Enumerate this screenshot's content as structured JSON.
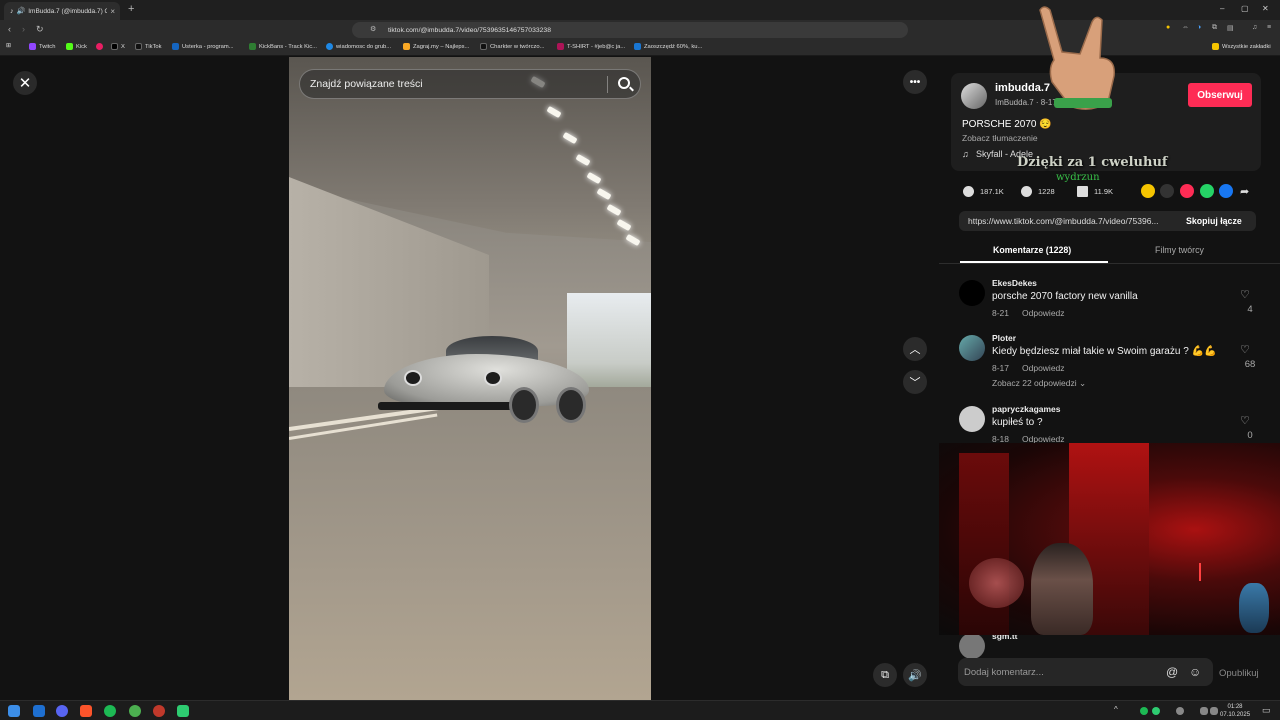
{
  "browser": {
    "tab_title": "ImBudda.7 (@imbudda.7) Oficj",
    "tab_close": "×",
    "new_tab": "+",
    "url": "tiktok.com/@imbudda.7/video/7539635146757033238",
    "window_controls": [
      "–",
      "▢",
      "✕"
    ],
    "bookmarks": [
      {
        "label": "Twitch",
        "color": "#9146ff"
      },
      {
        "label": "Kick",
        "color": "#53fc18"
      },
      {
        "label": "",
        "color": "#e91e63"
      },
      {
        "label": "X",
        "color": "#000000"
      },
      {
        "label": "TikTok",
        "color": "#111111"
      },
      {
        "label": "Usterka - program...",
        "color": "#1565c0"
      },
      {
        "label": "KickBans - Track Kic...",
        "color": "#2e7d32"
      },
      {
        "label": "wiadomosc do grub...",
        "color": "#1e88e5"
      },
      {
        "label": "Zagraj.my – Najleps...",
        "color": "#f9a825"
      },
      {
        "label": "Charkter w twórczo...",
        "color": "#111111"
      },
      {
        "label": "T-SHIRT - #jeb@c ja...",
        "color": "#ad1457"
      },
      {
        "label": "Zaoszczędź 60%, ku...",
        "color": "#1976d2"
      }
    ],
    "all_bookmarks": "Wszystkie zakładki"
  },
  "video": {
    "search_placeholder": "Znajdź powiązane treści",
    "more_label": "•••"
  },
  "post": {
    "username": "imbudda.7",
    "handle_date": "ImBudda.7 · 8-17",
    "follow_label": "Obserwuj",
    "caption": "PORSCHE 2070 😌",
    "translate_label": "Zobacz tłumaczenie",
    "music": "Skyfall - Adele",
    "likes": "187.1K",
    "comments_count": "1228",
    "saves": "11.9K",
    "link": "https://www.tiktok.com/@imbudda.7/video/75396...",
    "copy_label": "Skopiuj łącze"
  },
  "tabs": {
    "comments": "Komentarze (1228)",
    "creator_videos": "Filmy twórcy"
  },
  "comments": [
    {
      "name": "EkesDekes",
      "text": "porsche 2070 factory new vanilla",
      "date": "8-21",
      "reply": "Odpowiedz",
      "likes": "4"
    },
    {
      "name": "Ploter",
      "text": "Kiedy będziesz miał takie w Swoim garażu ? 💪💪",
      "date": "8-17",
      "reply": "Odpowiedz",
      "likes": "68",
      "more": "Zobacz 22 odpowiedzi ⌄"
    },
    {
      "name": "papryczkagames",
      "text": "kupiłeś to ?",
      "date": "8-18",
      "reply": "Odpowiedz",
      "likes": "0"
    },
    {
      "name": "sgm.tt"
    }
  ],
  "compose": {
    "placeholder": "Dodaj komentarz...",
    "post_label": "Opublikuj"
  },
  "overlay": {
    "text": "Dzięki za 1 cweluhuf",
    "sub": "wydrzun"
  },
  "taskbar": {
    "time": "01:28",
    "date": "07.10.2025"
  },
  "colors": {
    "accent": "#fe2c55"
  }
}
